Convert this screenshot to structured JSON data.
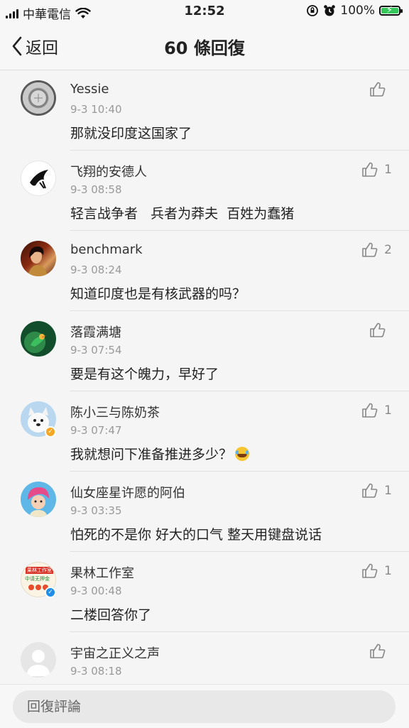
{
  "status_bar": {
    "carrier": "中華電信",
    "time": "12:52",
    "battery": "100%"
  },
  "nav": {
    "back_label": "返回",
    "title": "60 條回復"
  },
  "comments": [
    {
      "username": "Yessie",
      "time": "9-3 10:40",
      "text": "那就没印度这国家了",
      "likes": ""
    },
    {
      "username": "飞翔的安德人",
      "time": "9-3 08:58",
      "text": "轻言战争者   兵者为莽夫  百姓为蠢猪",
      "likes": "1"
    },
    {
      "username": "benchmark",
      "time": "9-3 08:24",
      "text": "知道印度也是有核武器的吗？",
      "likes": "2"
    },
    {
      "username": "落霞满塘",
      "time": "9-3 07:54",
      "text": "要是有这个魄力，早好了",
      "likes": ""
    },
    {
      "username": "陈小三与陈奶茶",
      "time": "9-3 07:47",
      "text": "我就想问下准备推进多少？",
      "likes": "1"
    },
    {
      "username": "仙女座星许愿的阿伯",
      "time": "9-3 03:35",
      "text": "怕死的不是你 好大的口气 整天用键盘说话",
      "likes": "1"
    },
    {
      "username": "果林工作室",
      "time": "9-3 00:48",
      "text": "二楼回答你了",
      "likes": "1"
    },
    {
      "username": "宇宙之正义之声",
      "time": "9-3 08:18",
      "text": "",
      "likes": ""
    }
  ],
  "avatar_badges": {
    "guolin_line1": "果林工作室",
    "guolin_line2": "中请无押金"
  },
  "reply": {
    "placeholder": "回復評論"
  },
  "colors": {
    "battery": "#34c759",
    "verified_gold": "#f5a623",
    "verified_blue": "#1e8ee8"
  }
}
